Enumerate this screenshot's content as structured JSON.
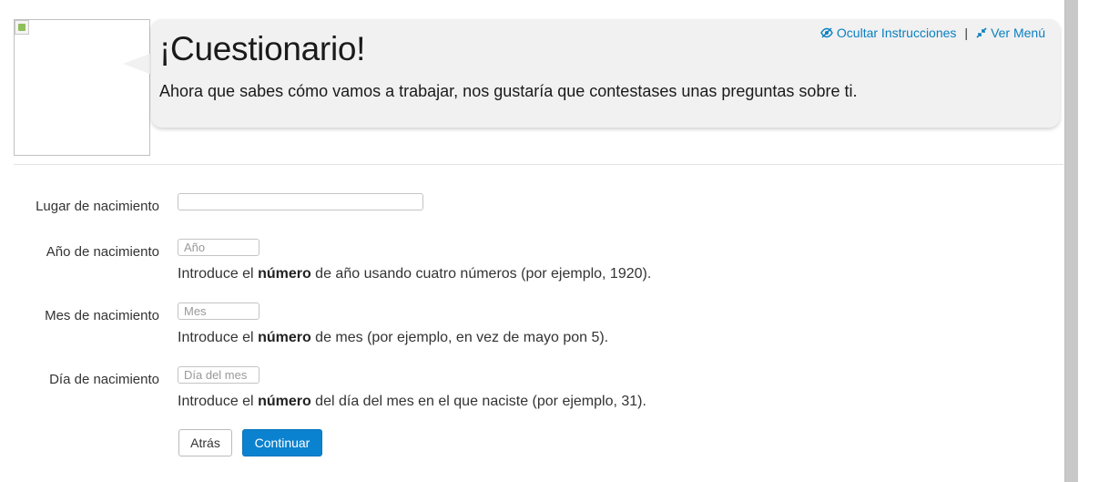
{
  "header": {
    "title": "¡Cuestionario!",
    "intro": "Ahora que sabes cómo vamos a trabajar, nos gustaría que contestases unas preguntas sobre ti.",
    "links": {
      "hide_instructions": "Ocultar Instrucciones",
      "separator": "|",
      "show_menu": "Ver Menú"
    }
  },
  "form": {
    "birthplace": {
      "label": "Lugar de nacimiento",
      "value": "",
      "placeholder": ""
    },
    "year": {
      "label": "Año de nacimiento",
      "placeholder": "Año",
      "help_before": "Introduce el ",
      "help_bold": "número",
      "help_after": " de año usando cuatro números (por ejemplo, 1920)."
    },
    "month": {
      "label": "Mes de nacimiento",
      "placeholder": "Mes",
      "help_before": "Introduce el ",
      "help_bold": "número",
      "help_after": " de mes (por ejemplo, en vez de mayo pon 5)."
    },
    "day": {
      "label": "Día de nacimiento",
      "placeholder": "Día del mes",
      "help_before": "Introduce el ",
      "help_bold": "número",
      "help_after": " del día del mes en el que naciste (por ejemplo, 31)."
    }
  },
  "buttons": {
    "back": "Atrás",
    "next": "Continuar"
  },
  "colors": {
    "link": "#0a7fc0",
    "primary_button": "#0a82cf",
    "bubble": "#f1f1f1"
  },
  "icons": {
    "hide_instructions": "eye-slash-icon",
    "show_menu": "compress-arrows-icon",
    "avatar": "broken-image-icon"
  }
}
